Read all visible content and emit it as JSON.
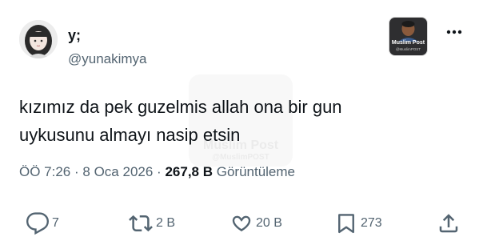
{
  "user": {
    "display_name": "y;",
    "handle": "@yunakimya"
  },
  "watermark": {
    "name": "Muslim Post",
    "handle": "@MuslimPOST"
  },
  "tweet": {
    "text_line1": "kızımız da pek guzelmis allah ona bir gun",
    "text_line2": "uykusunu almayı nasip etsin"
  },
  "meta": {
    "time": "ÖÖ 7:26",
    "separator": "·",
    "date": "8 Oca 2026",
    "views_count": "267,8 B",
    "views_label": "Görüntüleme"
  },
  "actions": {
    "reply_count": "7",
    "retweet_count": "2 B",
    "like_count": "20 B",
    "bookmark_count": "273"
  },
  "icons": {
    "more": "more-horizontal-icon",
    "reply": "reply-icon",
    "retweet": "retweet-icon",
    "like": "heart-icon",
    "bookmark": "bookmark-icon",
    "share": "share-icon"
  },
  "colors": {
    "text": "#0f1419",
    "secondary": "#536471",
    "background": "#ffffff"
  }
}
